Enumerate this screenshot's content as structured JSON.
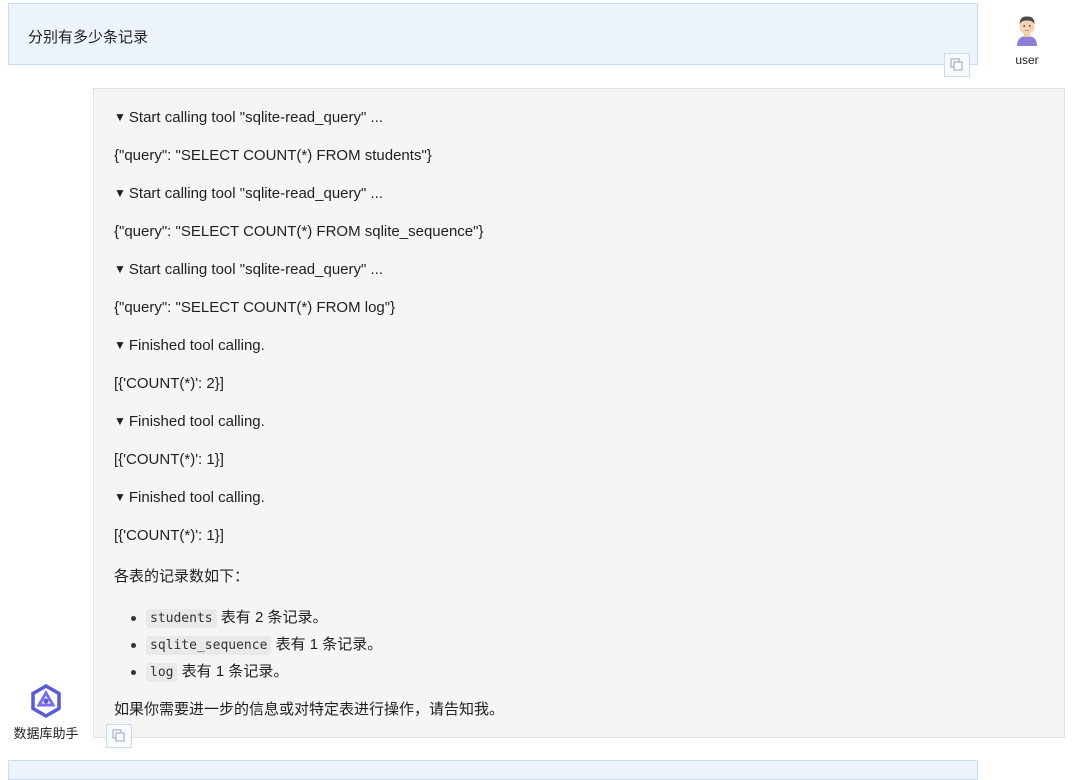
{
  "user_message": {
    "text": "分别有多少条记录",
    "avatar": "user-avatar-icon",
    "label": "user"
  },
  "bot_message": {
    "lines": [
      {
        "kind": "toggle",
        "text": "Start calling tool \"sqlite-read_query\" ..."
      },
      {
        "kind": "text",
        "text": "{\"query\": \"SELECT COUNT(*) FROM students\"}"
      },
      {
        "kind": "toggle",
        "text": "Start calling tool \"sqlite-read_query\" ..."
      },
      {
        "kind": "text",
        "text": "{\"query\": \"SELECT COUNT(*) FROM sqlite_sequence\"}"
      },
      {
        "kind": "toggle",
        "text": "Start calling tool \"sqlite-read_query\" ..."
      },
      {
        "kind": "text",
        "text": "{\"query\": \"SELECT COUNT(*) FROM log\"}"
      },
      {
        "kind": "toggle",
        "text": "Finished tool calling."
      },
      {
        "kind": "text",
        "text": "[{'COUNT(*)': 2}]"
      },
      {
        "kind": "toggle",
        "text": "Finished tool calling."
      },
      {
        "kind": "text",
        "text": "[{'COUNT(*)': 1}]"
      },
      {
        "kind": "toggle",
        "text": "Finished tool calling."
      },
      {
        "kind": "text",
        "text": "[{'COUNT(*)': 1}]"
      },
      {
        "kind": "text",
        "text": "各表的记录数如下："
      }
    ],
    "toggle_glyph": "▼",
    "bullets": [
      {
        "code": "students",
        "text": " 表有 2 条记录。"
      },
      {
        "code": "sqlite_sequence",
        "text": " 表有 1 条记录。"
      },
      {
        "code": "log",
        "text": " 表有 1 条记录。"
      }
    ],
    "closing": "如果你需要进一步的信息或对特定表进行操作，请告知我。",
    "avatar": "assistant-logo-icon",
    "label": "数据库助手"
  },
  "icons": {
    "copy": "copy-icon",
    "accent": "#5b5bd6"
  }
}
